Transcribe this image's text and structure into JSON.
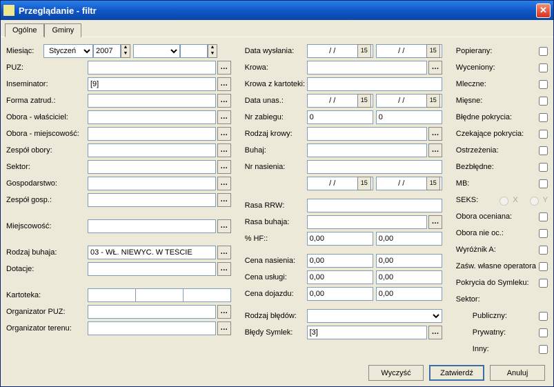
{
  "window": {
    "title": "Przeglądanie - filtr"
  },
  "tabs": {
    "general": "Ogólne",
    "gminy": "Gminy"
  },
  "left": {
    "miesiac": "Miesiąc:",
    "month_sel": "Styczeń",
    "year": "2007",
    "puz": "PUZ:",
    "inseminator": "Inseminator:",
    "inseminator_val": "[9]",
    "forma": "Forma zatrud.:",
    "obora_w": "Obora - właściciel:",
    "obora_m": "Obora - miejscowość:",
    "zespol_o": "Zespół obory:",
    "sektor": "Sektor:",
    "gosp": "Gospodarstwo:",
    "zespol_g": "Zespół gosp.:",
    "miejsc": "Miejscowość:",
    "rodzaj_b": "Rodzaj buhaja:",
    "rodzaj_b_val": "03 - WŁ. NIEWYC. W TEŚCIE",
    "dotacje": "Dotacje:",
    "kartoteka": "Kartoteka:",
    "org_puz": "Organizator PUZ:",
    "org_terenu": "Organizator terenu:"
  },
  "mid": {
    "data_w": "Data wysłania:",
    "date_placeholder": "/  /",
    "krowa": "Krowa:",
    "krowa_k": "Krowa z kartoteki:",
    "data_u": "Data unas.:",
    "nr_z": "Nr zabiegu:",
    "nr_z_v1": "0",
    "nr_z_v2": "0",
    "rodzaj_k": "Rodzaj krowy:",
    "buhaj": "Buhaj:",
    "nr_nas": "Nr nasienia:",
    "rasa_rrw": "Rasa RRW:",
    "rasa_b": "Rasa buhaja:",
    "hf": "% HF::",
    "cena_n": "Cena nasienia:",
    "cena_u": "Cena usługi:",
    "cena_d": "Cena dojazdu:",
    "zero": "0,00",
    "rodzaj_bl": "Rodzaj błędów:",
    "bledy_s": "Błędy Symlek:",
    "bledy_s_val": "[3]"
  },
  "right": {
    "popierany": "Popierany:",
    "wyceniony": "Wyceniony:",
    "mleczne": "Mleczne:",
    "miesne": "Mięsne:",
    "bledne": "Błędne pokrycia:",
    "czekajace": "Czekające pokrycia:",
    "ostrzezenia": "Ostrzeżenia:",
    "bezbledne": "Bezbłędne:",
    "mb": "MB:",
    "seks": "SEKS:",
    "seks_x": "X",
    "seks_y": "Y",
    "obora_oc": "Obora oceniana:",
    "obora_nie": "Obora nie oc.:",
    "wyroznik": "Wyróżnik A:",
    "zasw": "Zaśw. własne operatora",
    "pokrycia_s": "Pokrycia do Symleku:",
    "sektor": "Sektor:",
    "publiczny": "Publiczny:",
    "prywatny": "Prywatny:",
    "inny": "Inny:"
  },
  "footer": {
    "wyczysc": "Wyczyść",
    "zatwierdz": "Zatwierdź",
    "anuluj": "Anuluj"
  }
}
